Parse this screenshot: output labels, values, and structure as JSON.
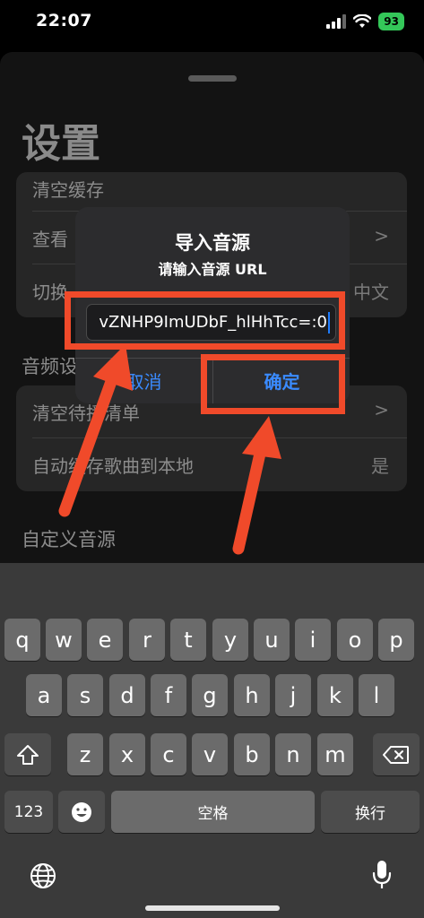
{
  "status_bar": {
    "time": "22:07",
    "battery": "93",
    "icons": [
      "signal-icon",
      "wifi-icon",
      "battery-icon"
    ]
  },
  "settings": {
    "title": "设置",
    "general_rows": [
      {
        "label": "清空缓存",
        "value": ""
      },
      {
        "label": "查看",
        "value": ">"
      },
      {
        "label": "切换",
        "value": "中文"
      }
    ],
    "audio_section_title": "音频设",
    "audio_rows": [
      {
        "label": "清空待播清单",
        "value": ">"
      },
      {
        "label": "自动缓存歌曲到本地",
        "value": "是"
      }
    ],
    "custom_source_title": "自定义音源"
  },
  "dialog": {
    "title": "导入音源",
    "message": "请输入音源 URL",
    "input_value": "vZNHP9ImUDbF_hlHhTcc=:0",
    "cancel_label": "取消",
    "confirm_label": "确定"
  },
  "keyboard": {
    "row1": [
      "q",
      "w",
      "e",
      "r",
      "t",
      "y",
      "u",
      "i",
      "o",
      "p"
    ],
    "row2": [
      "a",
      "s",
      "d",
      "f",
      "g",
      "h",
      "j",
      "k",
      "l"
    ],
    "row3": [
      "z",
      "x",
      "c",
      "v",
      "b",
      "n",
      "m"
    ],
    "numbers_label": "123",
    "space_label": "空格",
    "return_label": "换行",
    "icons": [
      "shift-icon",
      "delete-icon",
      "emoji-icon",
      "globe-icon",
      "microphone-icon"
    ]
  },
  "colors": {
    "highlight": "#f04a2a",
    "accent": "#3a8bff",
    "battery": "#34c759"
  }
}
